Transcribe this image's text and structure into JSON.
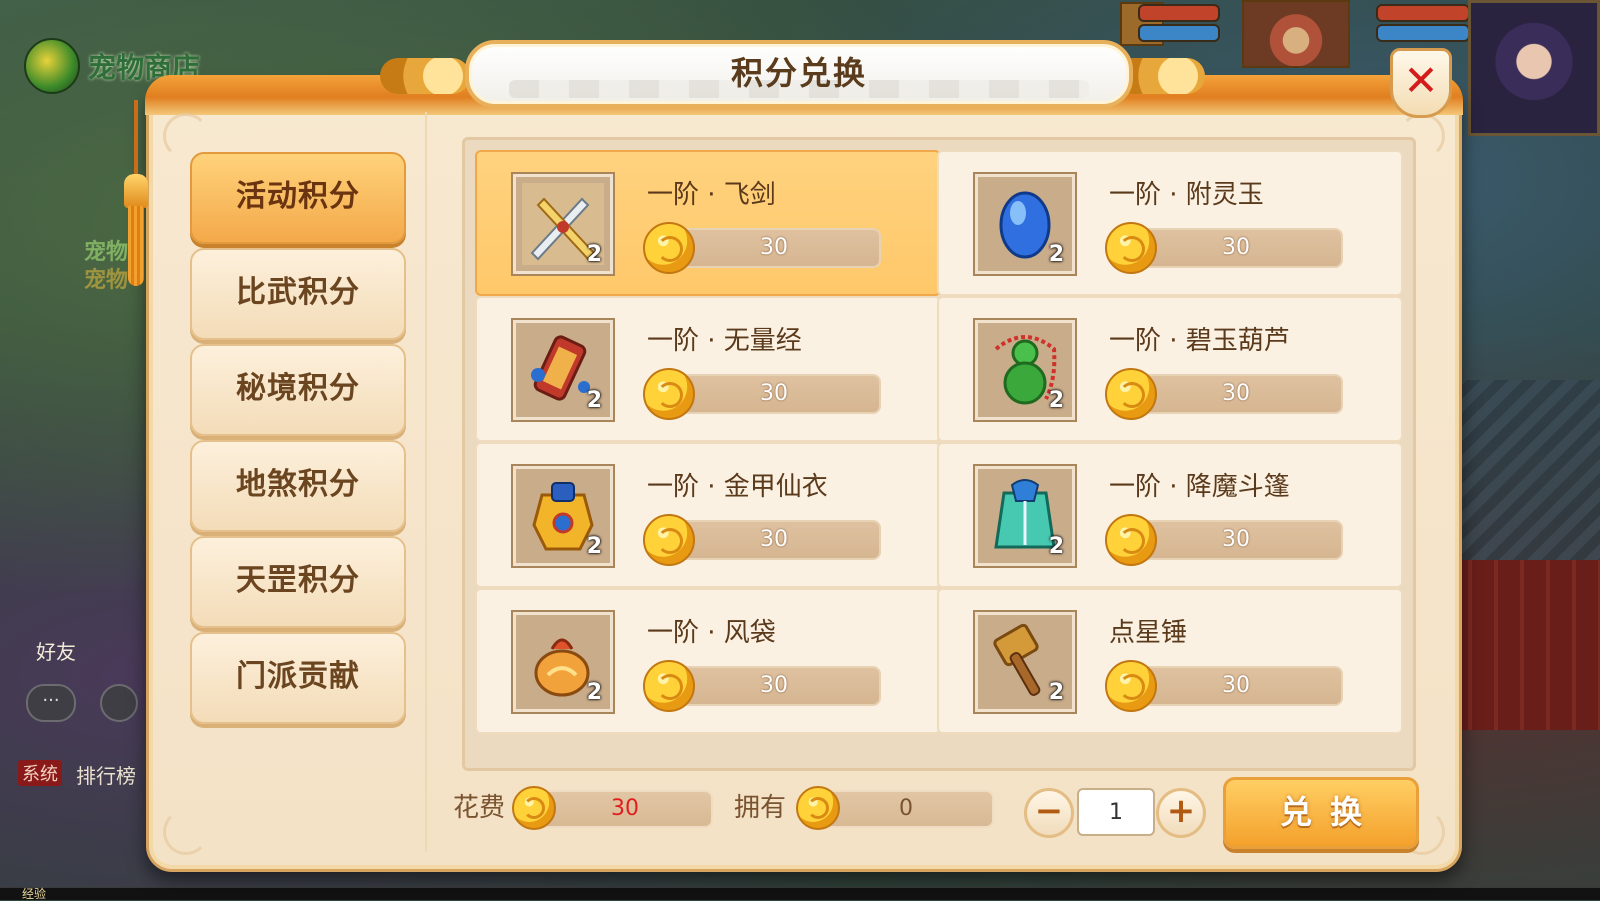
{
  "background": {
    "pet_store_label": "宠物商店",
    "side_labels": [
      "宠物",
      "宠物"
    ],
    "friend_label": "好友",
    "chat_label": "···",
    "system_tag": "系统",
    "rank_label": "排行榜",
    "exp_label": "经验"
  },
  "panel": {
    "title": "积分兑换",
    "close_label": "✕"
  },
  "tabs": [
    {
      "label": "活动积分",
      "active": true
    },
    {
      "label": "比武积分",
      "active": false
    },
    {
      "label": "秘境积分",
      "active": false
    },
    {
      "label": "地煞积分",
      "active": false
    },
    {
      "label": "天罡积分",
      "active": false
    },
    {
      "label": "门派贡献",
      "active": false
    }
  ],
  "items": [
    {
      "name": "一阶 · 飞剑",
      "price": "30",
      "qty": "2",
      "icon": "flying-sword-icon",
      "selected": true
    },
    {
      "name": "一阶 · 附灵玉",
      "price": "30",
      "qty": "2",
      "icon": "spirit-jade-icon",
      "selected": false
    },
    {
      "name": "一阶 · 无量经",
      "price": "30",
      "qty": "2",
      "icon": "scripture-scroll-icon",
      "selected": false
    },
    {
      "name": "一阶 · 碧玉葫芦",
      "price": "30",
      "qty": "2",
      "icon": "jade-gourd-icon",
      "selected": false
    },
    {
      "name": "一阶 · 金甲仙衣",
      "price": "30",
      "qty": "2",
      "icon": "golden-armor-icon",
      "selected": false
    },
    {
      "name": "一阶 · 降魔斗篷",
      "price": "30",
      "qty": "2",
      "icon": "demon-cloak-icon",
      "selected": false
    },
    {
      "name": "一阶 · 风袋",
      "price": "30",
      "qty": "2",
      "icon": "wind-bag-icon",
      "selected": false
    },
    {
      "name": "点星锤",
      "price": "30",
      "qty": "2",
      "icon": "star-hammer-icon",
      "selected": false
    }
  ],
  "footer": {
    "cost_label": "花费",
    "cost_value": "30",
    "own_label": "拥有",
    "own_value": "0",
    "quantity": "1",
    "minus_label": "−",
    "plus_label": "+",
    "exchange_label": "兑换"
  },
  "colors": {
    "accent": "#f4a12c",
    "cost_text": "#e02020",
    "close_x": "#d41c1c"
  }
}
